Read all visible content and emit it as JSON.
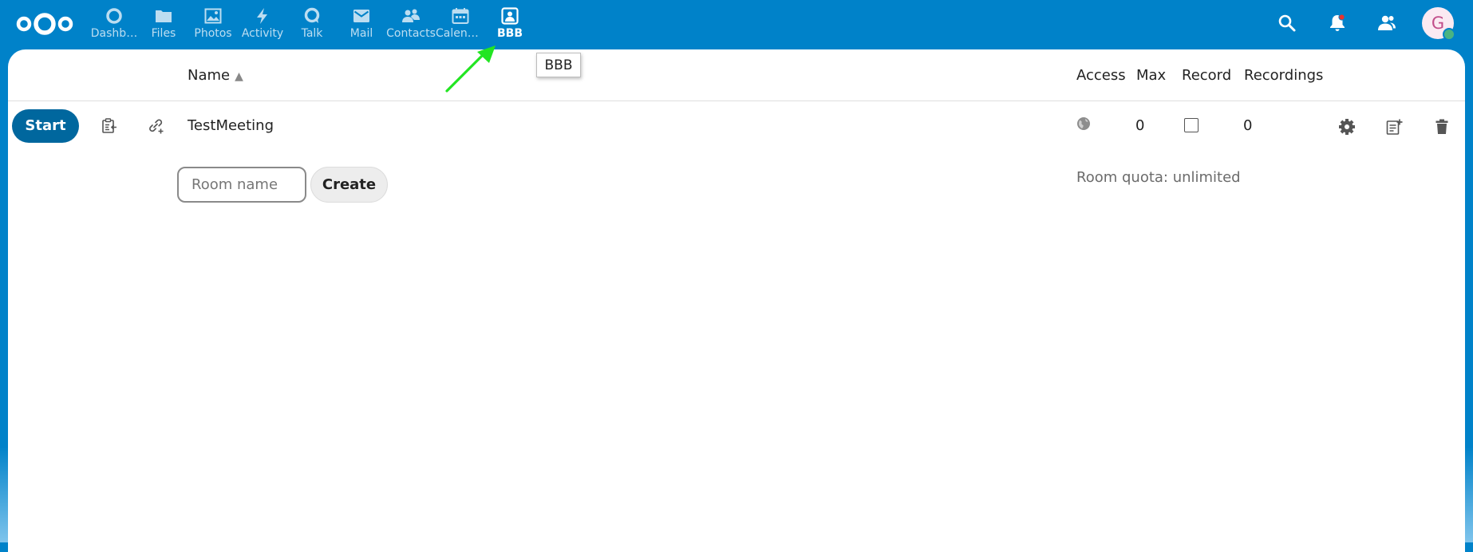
{
  "header": {
    "apps": [
      {
        "label": "Dashb…",
        "icon": "dashboard-icon"
      },
      {
        "label": "Files",
        "icon": "folder-icon"
      },
      {
        "label": "Photos",
        "icon": "image-icon"
      },
      {
        "label": "Activity",
        "icon": "lightning-icon"
      },
      {
        "label": "Talk",
        "icon": "talk-icon"
      },
      {
        "label": "Mail",
        "icon": "mail-icon"
      },
      {
        "label": "Contacts",
        "icon": "contacts-icon"
      },
      {
        "label": "Calendar",
        "icon": "calendar-icon"
      },
      {
        "label": "BBB",
        "icon": "bbb-icon"
      }
    ],
    "active_app": "BBB",
    "avatar_initial": "G"
  },
  "tooltip": "BBB",
  "table": {
    "columns": {
      "name": "Name",
      "access": "Access",
      "max": "Max",
      "record": "Record",
      "recordings": "Recordings"
    },
    "rows": [
      {
        "start_label": "Start",
        "name": "TestMeeting",
        "max": "0",
        "recordings": "0"
      }
    ]
  },
  "create_form": {
    "placeholder": "Room name",
    "create_label": "Create"
  },
  "quota": "Room quota: unlimited",
  "colors": {
    "brand": "#0082c9",
    "start_button": "#00679e",
    "annotation_arrow": "#22e522"
  }
}
